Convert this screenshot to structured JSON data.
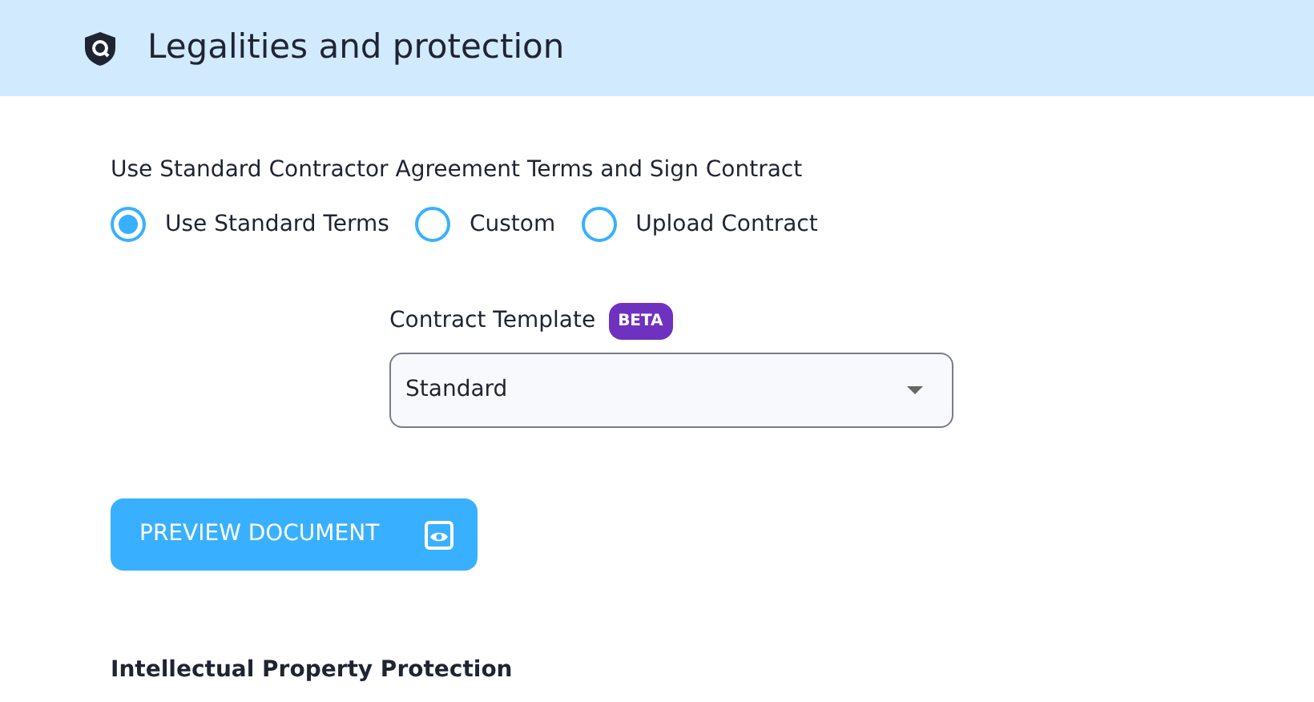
{
  "header": {
    "title": "Legalities and protection"
  },
  "agreement": {
    "question": "Use Standard Contractor Agreement Terms and Sign Contract",
    "options": [
      {
        "label": "Use Standard Terms",
        "selected": true
      },
      {
        "label": "Custom",
        "selected": false
      },
      {
        "label": "Upload Contract",
        "selected": false
      }
    ]
  },
  "template": {
    "label": "Contract Template",
    "badge": "BETA",
    "value": "Standard"
  },
  "preview_button": {
    "label": "PREVIEW DOCUMENT"
  },
  "next_section": {
    "title": "Intellectual Property Protection"
  }
}
